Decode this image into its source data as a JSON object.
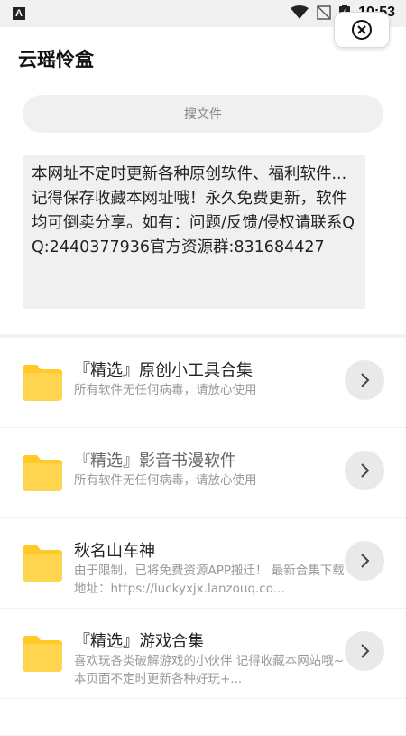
{
  "status_bar": {
    "time": "10:53",
    "app_badge": "A"
  },
  "app_bar": {
    "title": "云瑶怜盒"
  },
  "search": {
    "placeholder": "搜文件"
  },
  "notice": {
    "text": "本网址不定时更新各种原创软件、福利软件...记得保存收藏本网址哦！永久免费更新，软件均可倒卖分享。如有：问题/反馈/侵权请联系QQ:2440377936官方资源群:831684427"
  },
  "items": [
    {
      "title": "『精选』原创小工具合集",
      "subtitle": "所有软件无任何病毒，请放心使用",
      "muted": false
    },
    {
      "title": "『精选』影音书漫软件",
      "subtitle": "所有软件无任何病毒，请放心使用",
      "muted": true
    },
    {
      "title": "秋名山车神",
      "subtitle": "由于限制，已将免费资源APP搬迁！ 最新合集下载地址：https://luckyxjx.lanzouq.co...",
      "muted": false
    },
    {
      "title": "『精选』游戏合集",
      "subtitle": "喜欢玩各类破解游戏的小伙伴 记得收藏本网站哦~本页面不定时更新各种好玩+...",
      "muted": false
    }
  ],
  "colors": {
    "folder": "#FFD54F",
    "folder_tab": "#FFCA28"
  }
}
